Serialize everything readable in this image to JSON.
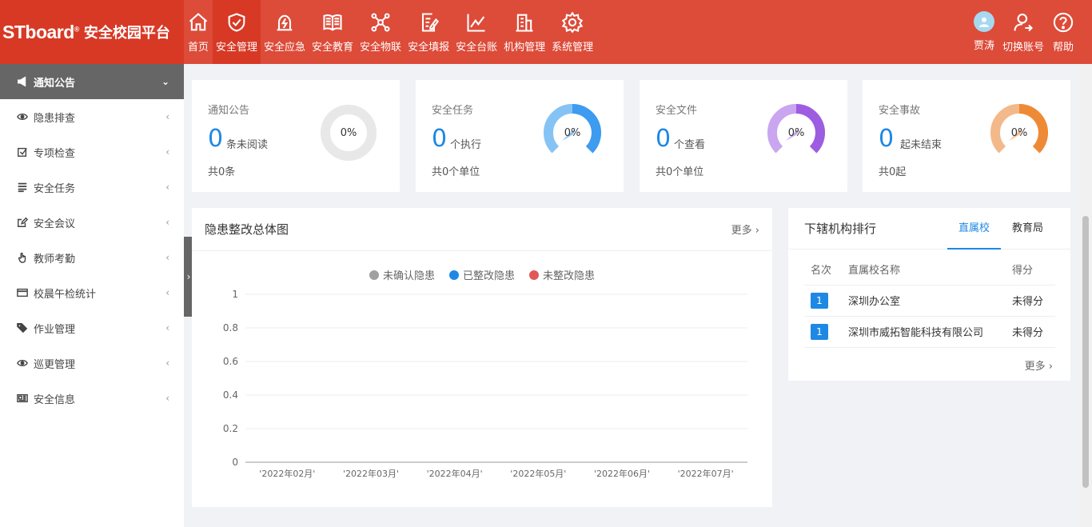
{
  "app": {
    "brand": "STboard",
    "reg": "®",
    "title": "安全校园平台"
  },
  "nav": [
    {
      "label": "首页",
      "icon": "home-icon"
    },
    {
      "label": "安全管理",
      "icon": "shield-check-icon"
    },
    {
      "label": "安全应急",
      "icon": "emergency-icon"
    },
    {
      "label": "安全教育",
      "icon": "book-icon"
    },
    {
      "label": "安全物联",
      "icon": "network-icon"
    },
    {
      "label": "安全填报",
      "icon": "edit-doc-icon"
    },
    {
      "label": "安全台账",
      "icon": "line-chart-icon"
    },
    {
      "label": "机构管理",
      "icon": "building-icon"
    },
    {
      "label": "系统管理",
      "icon": "gear-icon"
    }
  ],
  "user": {
    "name": "贾涛",
    "switch": "切换账号",
    "help": "帮助"
  },
  "sidebar": [
    {
      "label": "通知公告",
      "icon": "megaphone-icon",
      "arrow": "⌄"
    },
    {
      "label": "隐患排查",
      "icon": "eye-icon",
      "arrow": "‹"
    },
    {
      "label": "专项检查",
      "icon": "checkbox-icon",
      "arrow": "‹"
    },
    {
      "label": "安全任务",
      "icon": "list-icon",
      "arrow": "‹"
    },
    {
      "label": "安全会议",
      "icon": "pencil-square-icon",
      "arrow": "‹"
    },
    {
      "label": "教师考勤",
      "icon": "hand-pointer-icon",
      "arrow": "‹"
    },
    {
      "label": "校晨午检统计",
      "icon": "card-icon",
      "arrow": "‹"
    },
    {
      "label": "作业管理",
      "icon": "tags-icon",
      "arrow": "‹"
    },
    {
      "label": "巡更管理",
      "icon": "eye-icon",
      "arrow": "‹"
    },
    {
      "label": "安全信息",
      "icon": "newspaper-icon",
      "arrow": "‹"
    }
  ],
  "cards": [
    {
      "title": "通知公告",
      "num": "0",
      "unit": "条未阅读",
      "foot": "共0条",
      "pct": "0%",
      "color": "#e8e8e8",
      "percent": 0
    },
    {
      "title": "安全任务",
      "num": "0",
      "unit": "个执行",
      "foot": "共0个单位",
      "pct": "0%",
      "color": "#3d9bf0",
      "percent": 0
    },
    {
      "title": "安全文件",
      "num": "0",
      "unit": "个查看",
      "foot": "共0个单位",
      "pct": "0%",
      "color": "#9d5de0",
      "percent": 0
    },
    {
      "title": "安全事故",
      "num": "0",
      "unit": "起未结束",
      "foot": "共0起",
      "pct": "0%",
      "color": "#ee8a35",
      "percent": 0
    }
  ],
  "chart_panel": {
    "title": "隐患整改总体图",
    "more": "更多 ›"
  },
  "chart_data": {
    "type": "line",
    "categories": [
      "'2022年02月'",
      "'2022年03月'",
      "'2022年04月'",
      "'2022年05月'",
      "'2022年06月'",
      "'2022年07月'"
    ],
    "series": [
      {
        "name": "未确认隐患",
        "color": "#a0a0a0",
        "values": []
      },
      {
        "name": "已整改隐患",
        "color": "#1e88e5",
        "values": []
      },
      {
        "name": "未整改隐患",
        "color": "#e05858",
        "values": []
      }
    ],
    "yticks": [
      "0",
      "0.2",
      "0.4",
      "0.6",
      "0.8",
      "1"
    ],
    "ylim": [
      0,
      1
    ],
    "grid": true,
    "legend": "top-center"
  },
  "ranking": {
    "title": "下辖机构排行",
    "tabs": [
      "直属校",
      "教育局"
    ],
    "headers": [
      "名次",
      "直属校名称",
      "得分"
    ],
    "rows": [
      {
        "rank": "1",
        "name": "深圳办公室",
        "score": "未得分"
      },
      {
        "rank": "1",
        "name": "深圳市威拓智能科技有限公司",
        "score": "未得分"
      }
    ],
    "more": "更多 ›"
  },
  "handle": "›"
}
